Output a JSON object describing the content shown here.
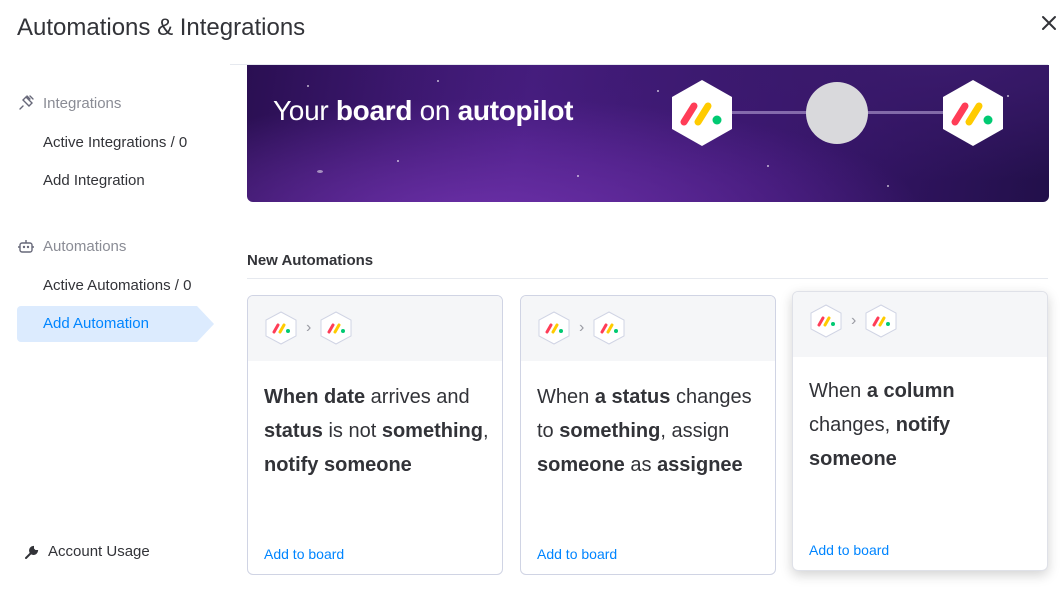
{
  "window": {
    "title": "Automations & Integrations"
  },
  "sidebar": {
    "integrations_header": "Integrations",
    "active_integrations": "Active Integrations / 0",
    "add_integration": "Add Integration",
    "automations_header": "Automations",
    "active_automations": "Active Automations / 0",
    "add_automation": "Add Automation",
    "account_usage": "Account Usage"
  },
  "banner": {
    "text_1": "Your ",
    "text_2": "board",
    "text_3": " on ",
    "text_4": "autopilot"
  },
  "section": {
    "title": "New Automations"
  },
  "cards": [
    {
      "parts": [
        "When ",
        "date",
        " arrives and ",
        "status",
        " is not ",
        "something",
        ", ",
        "notify someone"
      ],
      "link": "Add to board"
    },
    {
      "parts": [
        "When ",
        "a status",
        " changes to ",
        "something",
        ", assign ",
        "someone",
        " as ",
        "assignee"
      ],
      "link": "Add to board"
    },
    {
      "parts": [
        "When ",
        "a column",
        " changes, ",
        "notify someone"
      ],
      "link": "Add to board"
    }
  ],
  "colors": {
    "accent": "#0085ff",
    "active_bg": "#dcebfe",
    "logo_red": "#ff3d57",
    "logo_yellow": "#ffcb00",
    "logo_green": "#00ca72"
  }
}
